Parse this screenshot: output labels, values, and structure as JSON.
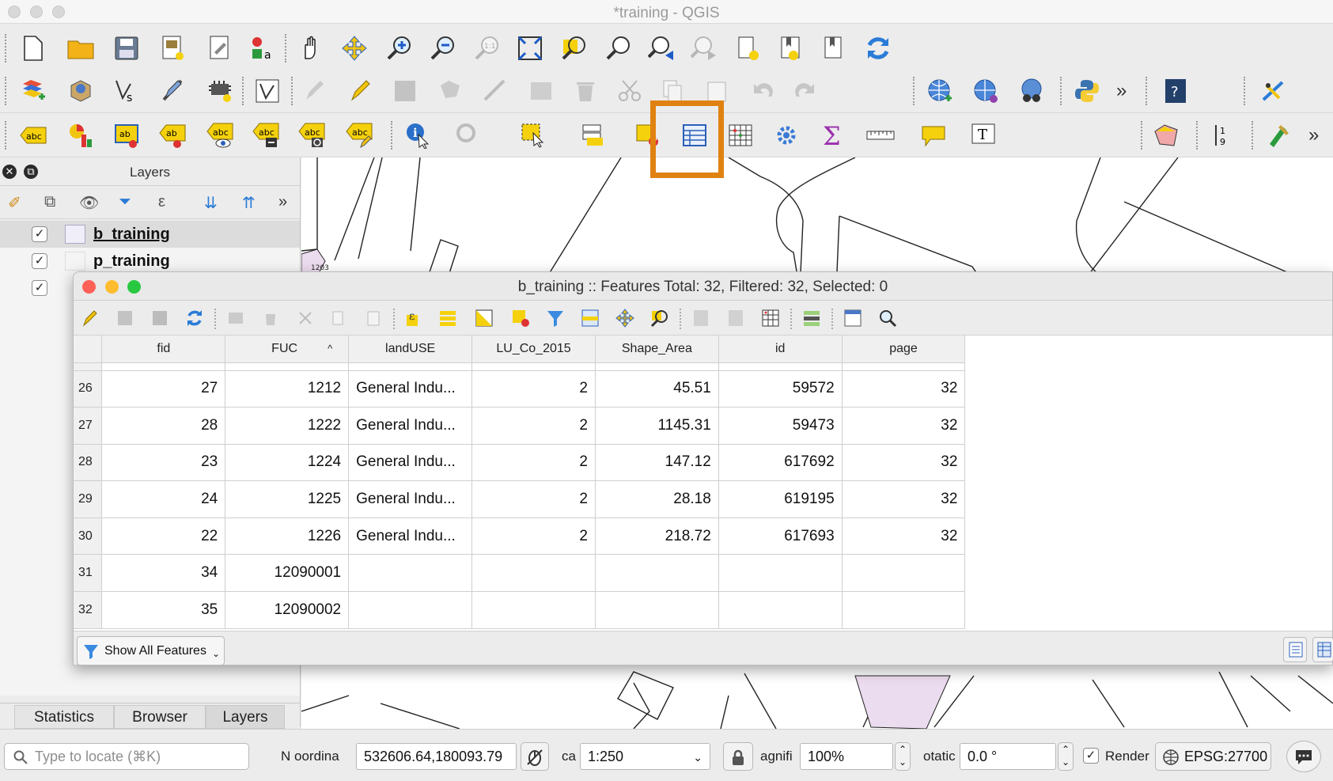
{
  "window": {
    "title": "*training - QGIS"
  },
  "layers_panel": {
    "title": "Layers",
    "layers": [
      {
        "name": "b_training",
        "checked": true,
        "selected": true
      },
      {
        "name": "p_training",
        "checked": true,
        "selected": false
      },
      {
        "name": "",
        "checked": true,
        "selected": false
      }
    ],
    "more_glyph": "»"
  },
  "map": {
    "parcel_label": "1203"
  },
  "attribute_table": {
    "title": "b_training :: Features Total: 32, Filtered: 32, Selected: 0",
    "columns": [
      "fid",
      "FUC",
      "landUSE",
      "LU_Co_2015",
      "Shape_Area",
      "id",
      "page"
    ],
    "sort_indicator": "^",
    "rows": [
      {
        "row": "26",
        "fid": "27",
        "FUC": "1212",
        "landUSE": "General Indu...",
        "LU_Co_2015": "2",
        "Shape_Area": "45.51",
        "id": "59572",
        "page": "32"
      },
      {
        "row": "27",
        "fid": "28",
        "FUC": "1222",
        "landUSE": "General Indu...",
        "LU_Co_2015": "2",
        "Shape_Area": "1145.31",
        "id": "59473",
        "page": "32"
      },
      {
        "row": "28",
        "fid": "23",
        "FUC": "1224",
        "landUSE": "General Indu...",
        "LU_Co_2015": "2",
        "Shape_Area": "147.12",
        "id": "617692",
        "page": "32"
      },
      {
        "row": "29",
        "fid": "24",
        "FUC": "1225",
        "landUSE": "General Indu...",
        "LU_Co_2015": "2",
        "Shape_Area": "28.18",
        "id": "619195",
        "page": "32"
      },
      {
        "row": "30",
        "fid": "22",
        "FUC": "1226",
        "landUSE": "General Indu...",
        "LU_Co_2015": "2",
        "Shape_Area": "218.72",
        "id": "617693",
        "page": "32"
      },
      {
        "row": "31",
        "fid": "34",
        "FUC": "12090001",
        "landUSE": "",
        "LU_Co_2015": "",
        "Shape_Area": "",
        "id": "",
        "page": ""
      },
      {
        "row": "32",
        "fid": "35",
        "FUC": "12090002",
        "landUSE": "",
        "LU_Co_2015": "",
        "Shape_Area": "",
        "id": "",
        "page": ""
      }
    ],
    "filter_button": "Show All Features"
  },
  "bottom_tabs": [
    "Statistics",
    "Browser",
    "Layers"
  ],
  "status_bar": {
    "locator_placeholder": "Type to locate (⌘K)",
    "coord_label": "N  oordina",
    "coordinate": "532606.64,180093.79",
    "scale_label": "ca",
    "scale": "1:250",
    "magnifier_label": "agnifi",
    "magnifier": "100%",
    "rotation_label": "otatic",
    "rotation": "0.0 °",
    "render_label": "Render",
    "render_checked": true,
    "crs": "EPSG:27700"
  },
  "colors": {
    "highlight": "#e08212",
    "close": "#fe5f57",
    "minimize": "#febc2e",
    "zoom": "#28c840"
  }
}
